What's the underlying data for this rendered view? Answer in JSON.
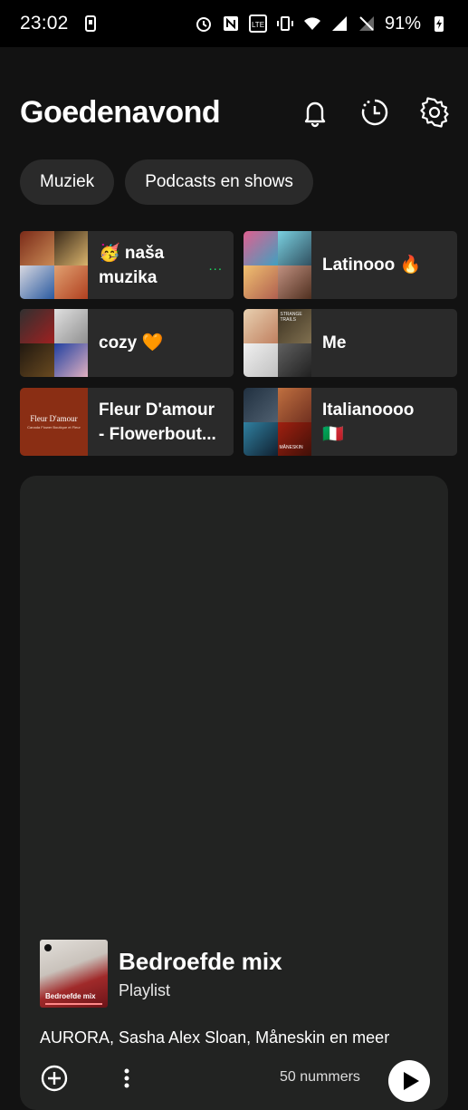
{
  "status_bar": {
    "time": "23:02",
    "battery": "91%",
    "icons": [
      "sim-icon",
      "alarm-icon",
      "nfc-icon",
      "volte-icon",
      "vibrate-icon",
      "wifi-icon",
      "signal-icon",
      "no-sim-icon",
      "battery-charging-icon"
    ]
  },
  "header": {
    "greeting": "Goedenavond",
    "icons": [
      "bell-icon",
      "recent-history-icon",
      "settings-icon"
    ]
  },
  "filters": [
    "Muziek",
    "Podcasts en shows"
  ],
  "shortcuts": [
    {
      "line1": "🥳 naša",
      "line2": "muzika",
      "more": "..."
    },
    {
      "line1": "Latinooo 🔥",
      "line2": ""
    },
    {
      "line1": "cozy 🧡",
      "line2": ""
    },
    {
      "line1": "Me",
      "line2": ""
    },
    {
      "line1": "Fleur D'amour",
      "line2": "- Flowerbout..."
    },
    {
      "line1": "Italianoooo",
      "line2": "🇮🇹"
    }
  ],
  "art_labels": {
    "fleur_title": "Fleur D'amour",
    "fleur_sub": "Canada Flower Boutique et Fleur",
    "strange_trails": "STRANGE TRAILS",
    "maneskin": "MÅNESKIN"
  },
  "featured": {
    "title": "Bedroefde mix",
    "type": "Playlist",
    "thumb_label": "Bedroefde mix",
    "artists": "AURORA, Sasha Alex Sloan, Måneskin en meer",
    "count": "50 nummers"
  },
  "colors": {
    "background": "#121212",
    "tile": "#2a2a2a",
    "accent": "#1ed760"
  }
}
